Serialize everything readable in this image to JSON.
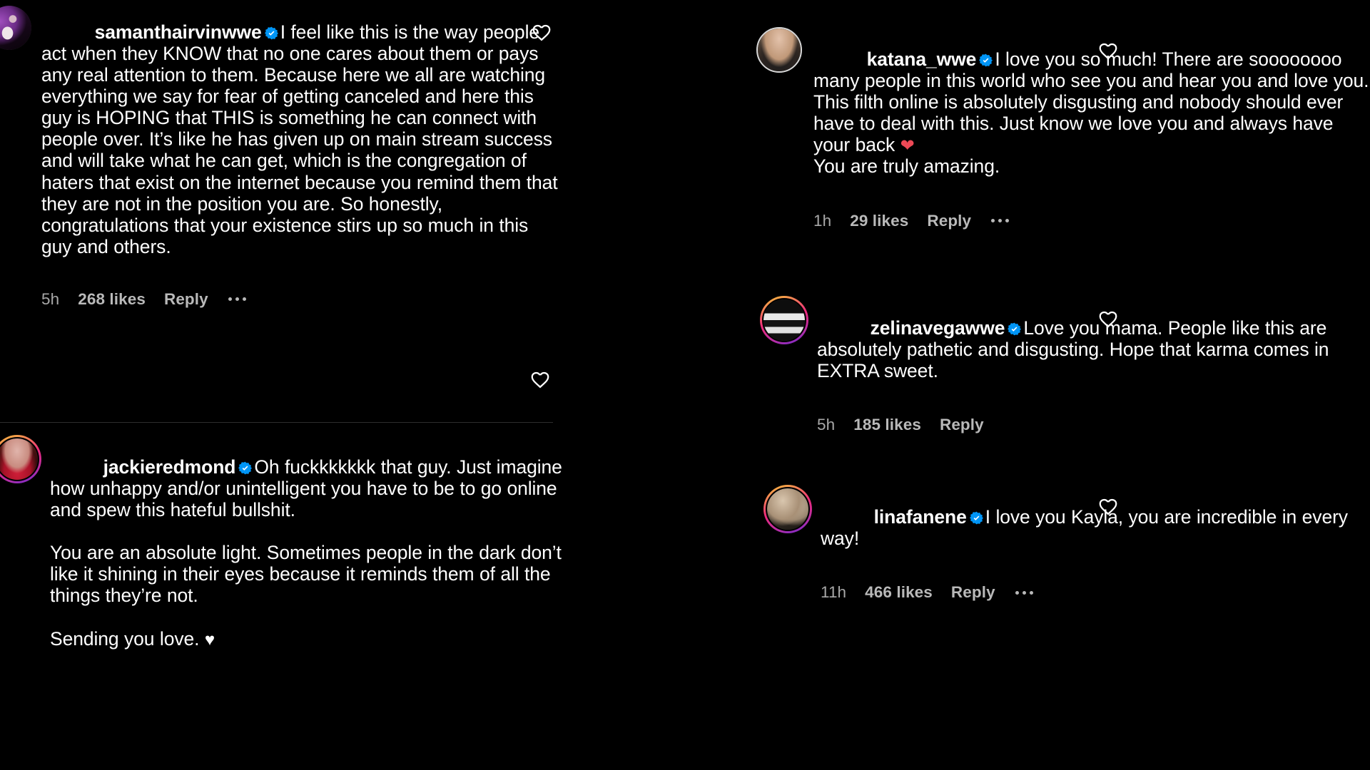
{
  "app": {
    "name": "Instagram",
    "view": "comments",
    "theme": "dark",
    "background_color": "#000000",
    "text_color": "#ffffff",
    "meta_text_color": "#a8a8a8",
    "verified_badge_color": "#0095f6",
    "divider_color": "#2e2e2e",
    "heart_icon_color": "#ffffff",
    "red_heart_color": "#ed4956"
  },
  "columns": {
    "left": {
      "comments": [
        {
          "username": "samanthairvinwwe",
          "verified": true,
          "text": "I feel like this is the way people act when they KNOW that no one cares about them or pays any real attention to them. Because here we all are watching everything we say for fear of getting canceled and here this guy is HOPING that THIS is something he can connect with people over. It’s like he has given up on main stream success and will take what he can get, which is the congregation of haters that exist on the internet because you remind them that they are not in the position you are. So honestly, congratulations that your existence stirs up so much in this guy and others.",
          "time": "5h",
          "likes": "268 likes",
          "reply": "Reply",
          "has_more_menu": true,
          "has_like_heart": true,
          "avatar_ring": "none",
          "avatar_colors": [
            "#2b0d36",
            "#8b3fa8",
            "#d9c2cf"
          ]
        },
        {
          "username": "jackieredmond",
          "verified": true,
          "text": "Oh fuckkkkkkk that guy. Just imagine how unhappy and/or unintelligent you have to be to go online and spew this hateful bullshit.\n\nYou are an absolute light. Sometimes people in the dark don’t like it shining in their eyes because it reminds them of all the things they’re not.\n\nSending you love. ",
          "trailing_emoji": "♥",
          "trailing_emoji_name": "white-heart",
          "time": "",
          "likes": "",
          "reply": "",
          "has_more_menu": false,
          "has_like_heart": true,
          "avatar_ring": "gradient",
          "avatar_colors": [
            "#5c1414",
            "#c8213a",
            "#e8a0a8"
          ]
        }
      ]
    },
    "right": {
      "comments": [
        {
          "username": "katana_wwe",
          "verified": true,
          "text": "I love you so much! There are soooooooo many people in this world who see you and hear you and love you. This filth online is absolutely disgusting and nobody should ever have to deal with this. Just know we love you and always have your back ",
          "trailing_emoji": "❤",
          "trailing_emoji_name": "red-heart",
          "text_after_emoji": "\nYou are truly amazing.",
          "time": "1h",
          "likes": "29 likes",
          "reply": "Reply",
          "has_more_menu": true,
          "has_like_heart": true,
          "avatar_ring": "none",
          "avatar_colors": [
            "#3b2a24",
            "#8a6a58",
            "#d2b9a6"
          ]
        },
        {
          "username": "zelinavegawwe",
          "verified": true,
          "text": "Love you mama. People like this are absolutely pathetic and disgusting. Hope that karma comes in EXTRA sweet.",
          "time": "5h",
          "likes": "185 likes",
          "reply": "Reply",
          "has_more_menu": false,
          "has_like_heart": true,
          "avatar_ring": "gradient",
          "avatar_colors": [
            "#101010",
            "#3a3a3a",
            "#c9c9c9"
          ]
        },
        {
          "username": "linafanene",
          "verified": true,
          "text": "I love you Kayla, you are incredible in every way!",
          "time": "11h",
          "likes": "466 likes",
          "reply": "Reply",
          "has_more_menu": true,
          "has_like_heart": true,
          "avatar_ring": "gradient",
          "avatar_colors": [
            "#4a4035",
            "#8e8274",
            "#cdbfae"
          ]
        }
      ]
    }
  },
  "icons": {
    "like_heart": "heart-outline-icon",
    "verified": "verified-badge-icon",
    "more_menu": "more-options-icon"
  }
}
